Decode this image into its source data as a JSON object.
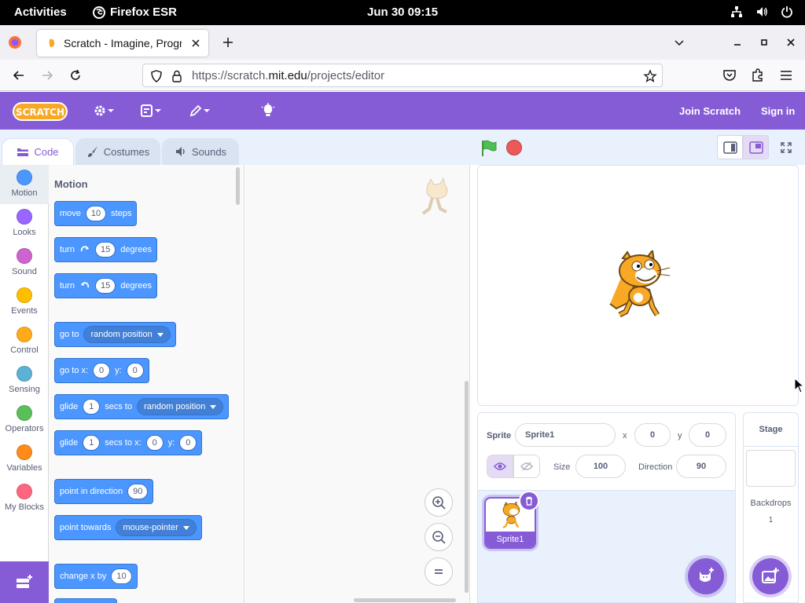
{
  "system_bar": {
    "activities": "Activities",
    "app_name": "Firefox ESR",
    "clock": "Jun 30  09:15"
  },
  "browser": {
    "tab_title": "Scratch - Imagine, Program, Create",
    "url_prefix": "https://scratch.",
    "url_domain": "mit.edu",
    "url_path": "/projects/editor"
  },
  "scratch_menu": {
    "logo_text": "SCRATCH",
    "join": "Join Scratch",
    "signin": "Sign in"
  },
  "editor_tabs": {
    "code": "Code",
    "costumes": "Costumes",
    "sounds": "Sounds"
  },
  "categories": [
    {
      "label": "Motion",
      "color": "#4c97ff"
    },
    {
      "label": "Looks",
      "color": "#9966ff"
    },
    {
      "label": "Sound",
      "color": "#cf63cf"
    },
    {
      "label": "Events",
      "color": "#ffbf00"
    },
    {
      "label": "Control",
      "color": "#ffab19"
    },
    {
      "label": "Sensing",
      "color": "#5cb1d6"
    },
    {
      "label": "Operators",
      "color": "#59c059"
    },
    {
      "label": "Variables",
      "color": "#ff8c1a"
    },
    {
      "label": "My Blocks",
      "color": "#ff6680"
    }
  ],
  "flyout": {
    "heading": "Motion",
    "blocks": {
      "move": {
        "a": "move",
        "v": "10",
        "b": "steps"
      },
      "turn_right": {
        "a": "turn",
        "v": "15",
        "b": "degrees"
      },
      "turn_left": {
        "a": "turn",
        "v": "15",
        "b": "degrees"
      },
      "goto": {
        "a": "go to",
        "dd": "random position"
      },
      "goto_xy": {
        "a": "go to x:",
        "x": "0",
        "b": "y:",
        "y": "0"
      },
      "glide_to": {
        "a": "glide",
        "v": "1",
        "b": "secs to",
        "dd": "random position"
      },
      "glide_xy": {
        "a": "glide",
        "v": "1",
        "b": "secs to x:",
        "x": "0",
        "c": "y:",
        "y": "0"
      },
      "point_dir": {
        "a": "point in direction",
        "v": "90"
      },
      "point_towards": {
        "a": "point towards",
        "dd": "mouse-pointer"
      },
      "change_x": {
        "a": "change x by",
        "v": "10"
      }
    }
  },
  "sprite_info": {
    "sprite_label": "Sprite",
    "sprite_name": "Sprite1",
    "x_label": "x",
    "x_value": "0",
    "y_label": "y",
    "y_value": "0",
    "size_label": "Size",
    "size_value": "100",
    "direction_label": "Direction",
    "direction_value": "90"
  },
  "sprites": [
    {
      "name": "Sprite1"
    }
  ],
  "stage_selector": {
    "title": "Stage",
    "backdrops_label": "Backdrops",
    "backdrops_count": "1"
  },
  "colors": {
    "scratch_purple": "#855cd6",
    "motion_blue": "#4c97ff"
  }
}
